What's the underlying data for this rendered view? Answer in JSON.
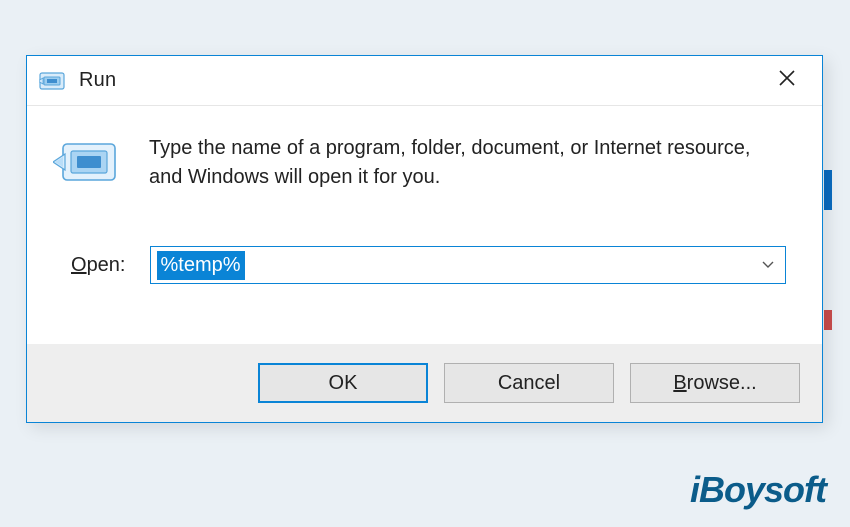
{
  "dialog": {
    "title": "Run",
    "prompt": "Type the name of a program, folder, document, or Internet resource, and Windows will open it for you.",
    "open_label_underlined": "O",
    "open_label_rest": "pen:",
    "input_value": "%temp%",
    "buttons": {
      "ok": "OK",
      "cancel": "Cancel",
      "browse_underlined": "B",
      "browse_rest": "rowse..."
    }
  },
  "watermark": "iBoysoft"
}
